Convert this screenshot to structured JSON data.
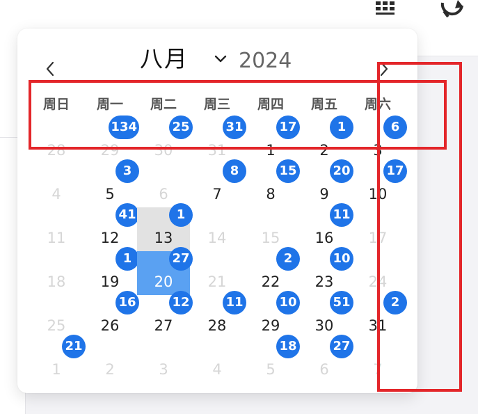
{
  "header": {
    "month": "八月",
    "year": "2024"
  },
  "weekdays": [
    "周日",
    "周一",
    "周二",
    "周三",
    "周四",
    "周五",
    "周六"
  ],
  "weeks": [
    [
      {
        "day": "28",
        "other": true
      },
      {
        "day": "29",
        "other": true,
        "badge": "134"
      },
      {
        "day": "30",
        "other": true,
        "badge": "25"
      },
      {
        "day": "31",
        "other": true,
        "badge": "31"
      },
      {
        "day": "1",
        "badge": "17"
      },
      {
        "day": "2",
        "badge": "1"
      },
      {
        "day": "3",
        "badge": "6"
      }
    ],
    [
      {
        "day": "4",
        "other": true
      },
      {
        "day": "5",
        "badge": "3"
      },
      {
        "day": "6",
        "other": true
      },
      {
        "day": "7",
        "badge": "8"
      },
      {
        "day": "8",
        "badge": "15"
      },
      {
        "day": "9",
        "badge": "20"
      },
      {
        "day": "10",
        "badge": "17"
      }
    ],
    [
      {
        "day": "11",
        "other": true
      },
      {
        "day": "12",
        "badge": "41"
      },
      {
        "day": "13",
        "today": true,
        "badge": "1"
      },
      {
        "day": "14",
        "other": true
      },
      {
        "day": "15",
        "other": true
      },
      {
        "day": "16",
        "badge": "11"
      },
      {
        "day": "17",
        "other": true
      }
    ],
    [
      {
        "day": "18",
        "other": true
      },
      {
        "day": "19",
        "badge": "1"
      },
      {
        "day": "20",
        "selected": true,
        "badge": "27"
      },
      {
        "day": "21",
        "other": true
      },
      {
        "day": "22",
        "badge": "2"
      },
      {
        "day": "23",
        "badge": "10"
      },
      {
        "day": "24",
        "other": true
      }
    ],
    [
      {
        "day": "25",
        "other": true
      },
      {
        "day": "26",
        "badge": "16"
      },
      {
        "day": "27",
        "badge": "12"
      },
      {
        "day": "28",
        "badge": "11"
      },
      {
        "day": "29",
        "badge": "10"
      },
      {
        "day": "30",
        "badge": "51"
      },
      {
        "day": "31",
        "badge": "2"
      }
    ],
    [
      {
        "day": "1",
        "other": true,
        "badge": "21"
      },
      {
        "day": "2",
        "other": true
      },
      {
        "day": "3",
        "other": true
      },
      {
        "day": "4",
        "other": true
      },
      {
        "day": "5",
        "other": true,
        "badge": "18"
      },
      {
        "day": "6",
        "other": true,
        "badge": "27"
      },
      {
        "day": "7",
        "other": true
      }
    ]
  ],
  "colors": {
    "badge": "#1f74e8",
    "selected": "#5aa1f2",
    "today": "#e2e2e2",
    "highlight": "#e3262a"
  }
}
